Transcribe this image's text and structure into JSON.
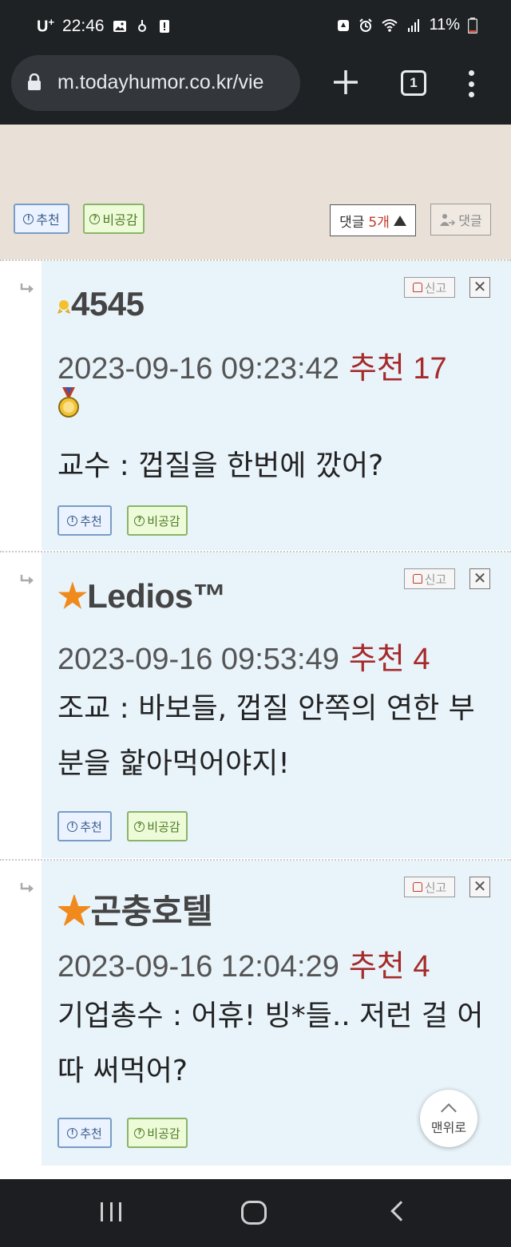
{
  "status_bar": {
    "carrier": "U",
    "carrier_plus": "+",
    "time": "22:46",
    "battery": "11%"
  },
  "browser": {
    "url": "m.todayhumor.co.kr/vie",
    "tab_count": "1"
  },
  "post_actions": {
    "recommend_label": "추천",
    "unlike_label": "비공감",
    "comments_label": "댓글",
    "comments_count": "5개",
    "reply_label": "댓글"
  },
  "comment_actions": {
    "report_label": "신고",
    "close_label": "✕",
    "recommend_label": "추천",
    "unlike_label": "비공감"
  },
  "comments": [
    {
      "author": "4545",
      "datetime": "2023-09-16 09:23:42",
      "recommend": "추천 17",
      "text": "교수 : 껍질을 한번에 깠어?"
    },
    {
      "author": "Ledios™",
      "star": "★",
      "datetime": "2023-09-16 09:53:49",
      "recommend": "추천 4",
      "text": "조교 : 바보들, 껍질 안쪽의 연한 부분을 핥아먹어야지!"
    },
    {
      "author": "곤충호텔",
      "star": "★",
      "datetime": "2023-09-16 12:04:29",
      "recommend": "추천 4",
      "text": "기업총수 : 어휴! 빙*들.. 저런 걸 어따 써먹어?"
    }
  ],
  "top_button": "맨위로",
  "colors": {
    "comment_bg": "#e8f3fa",
    "recommend_red": "#a52a2a",
    "star_orange": "#f08a1c",
    "beige": "#e9e1d7"
  }
}
